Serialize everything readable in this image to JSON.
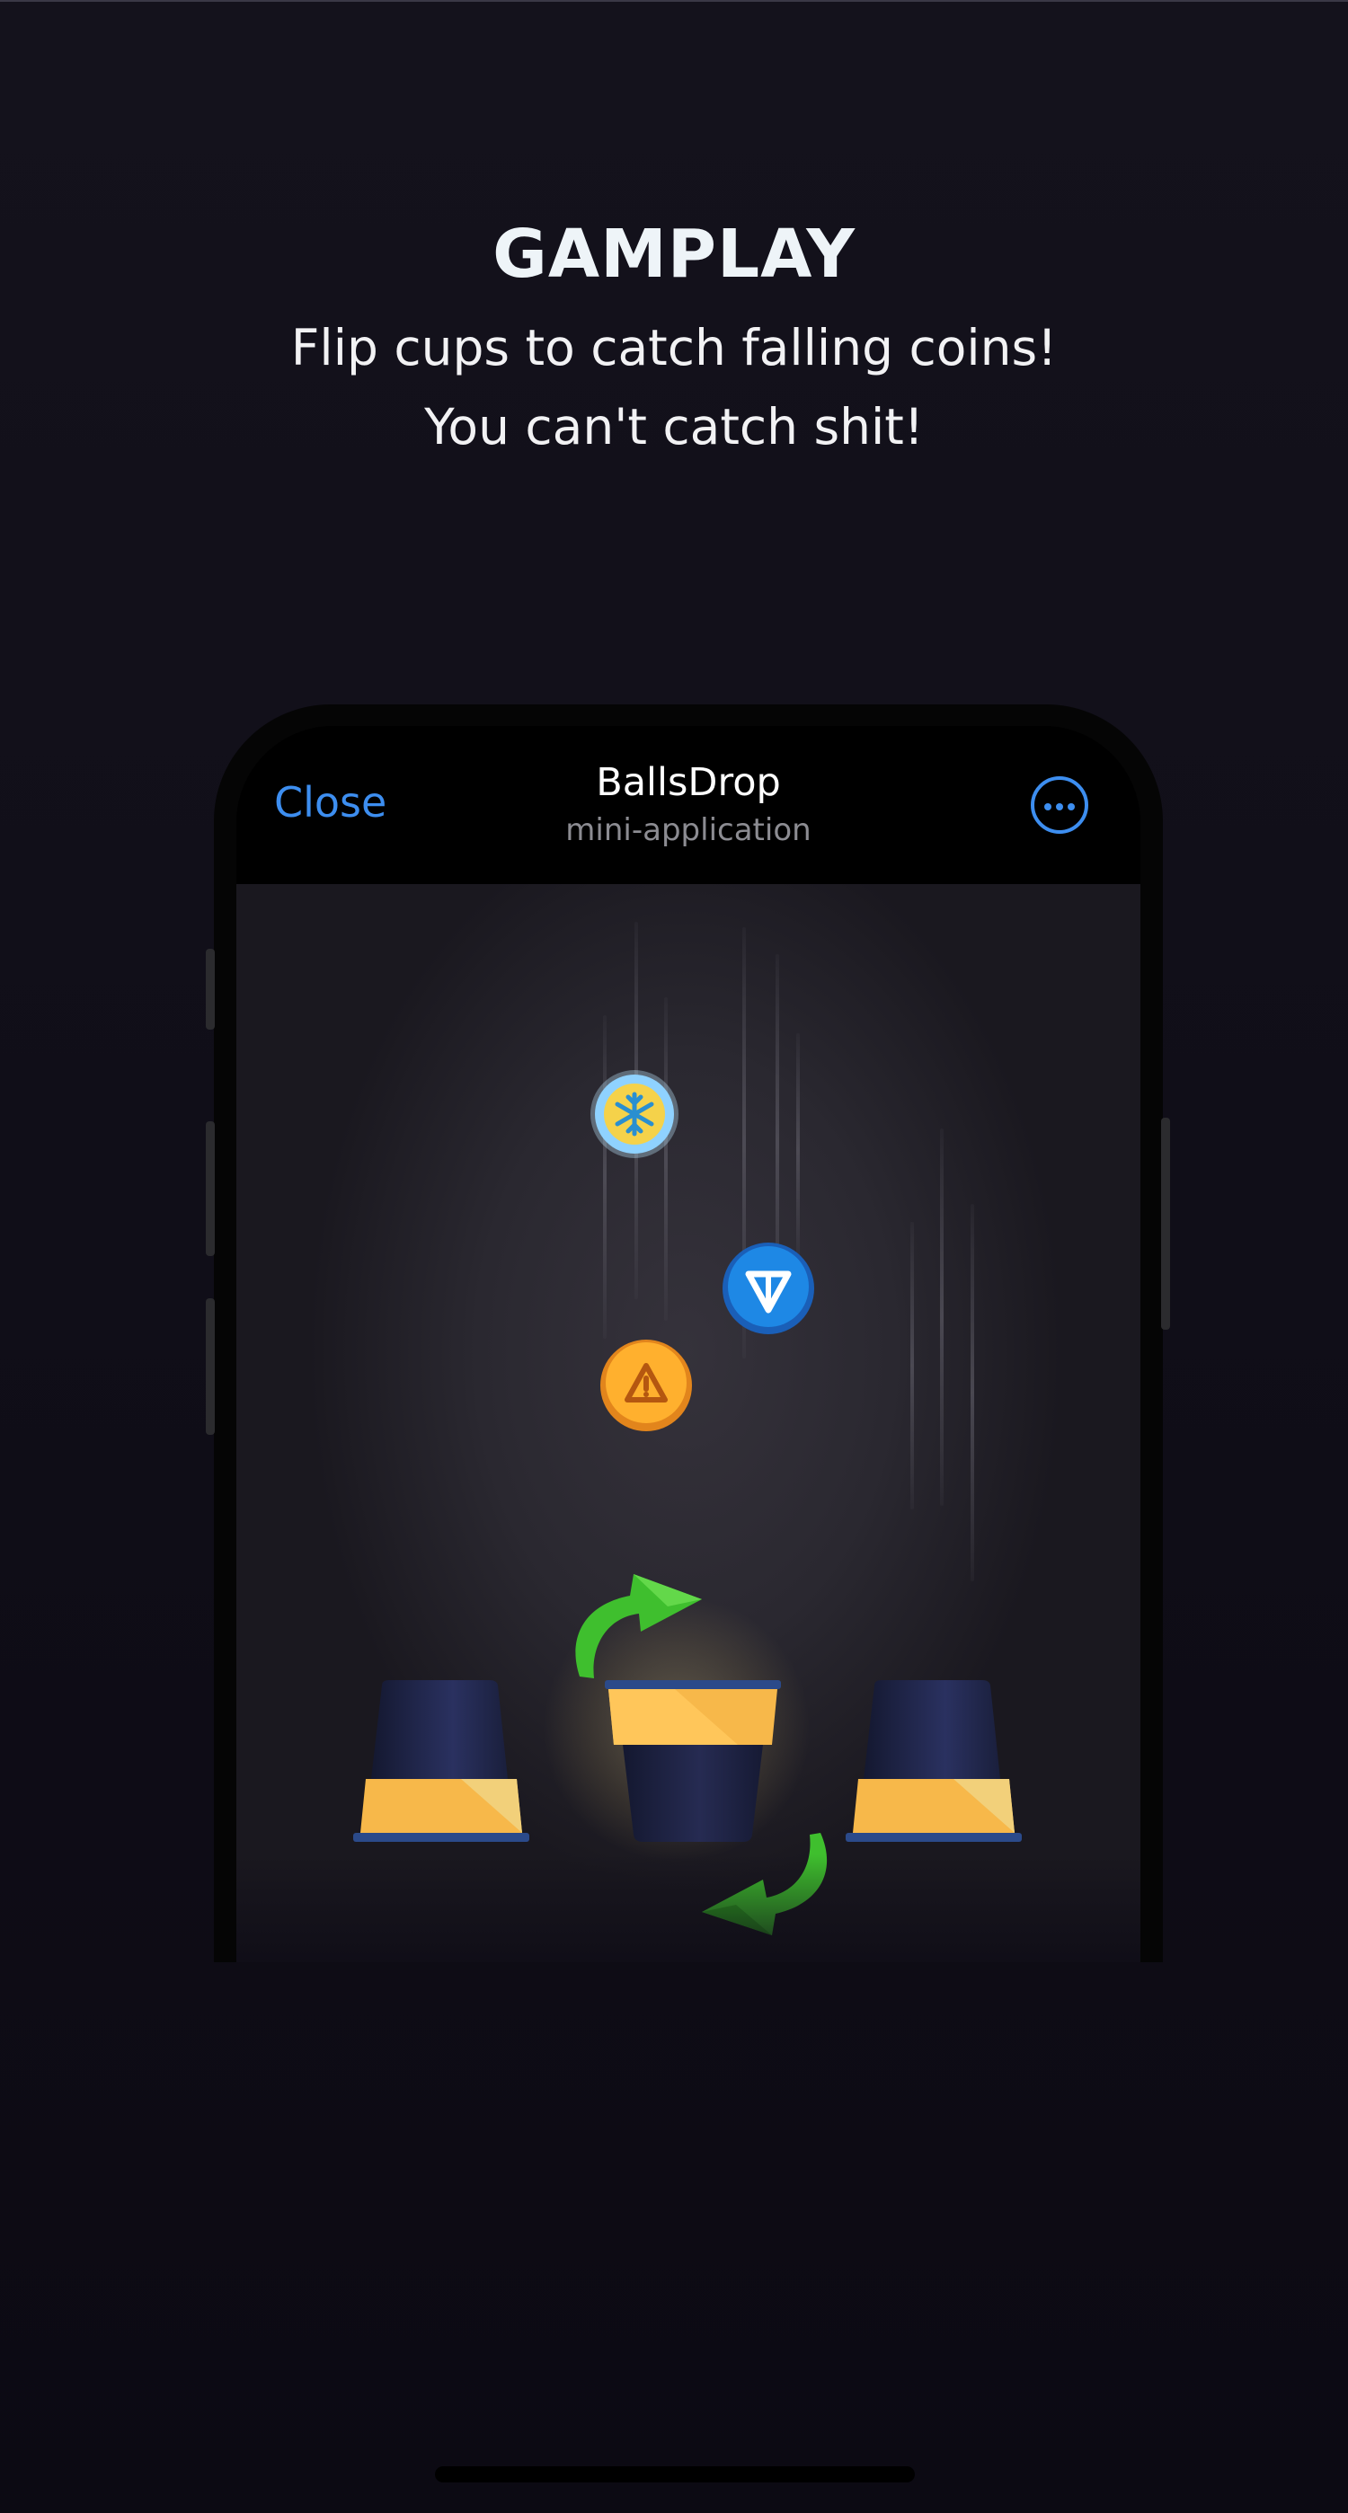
{
  "promo": {
    "headline": "GAMPLAY",
    "subtitle_line1": "Flip cups to catch falling coins!",
    "subtitle_line2": "You can't catch shit!"
  },
  "app_bar": {
    "close_label": "Close",
    "title": "BallsDrop",
    "subtitle": "mini-application",
    "more_icon": "ellipsis-circle-icon"
  },
  "game": {
    "coins": [
      "snowflake-coin-icon",
      "ton-coin-icon",
      "warning-coin-icon"
    ],
    "cups": [
      "left-cup-inverted",
      "center-cup-upright",
      "right-cup-inverted"
    ],
    "flip_arrows": [
      "flip-arrow-top-icon",
      "flip-arrow-bottom-icon"
    ]
  },
  "colors": {
    "accent": "#3d8ef0",
    "cup_gold": "#f7b84a",
    "cup_navy": "#1f2344",
    "arrow_green": "#3fbf2e",
    "background": "#0e0c16"
  }
}
